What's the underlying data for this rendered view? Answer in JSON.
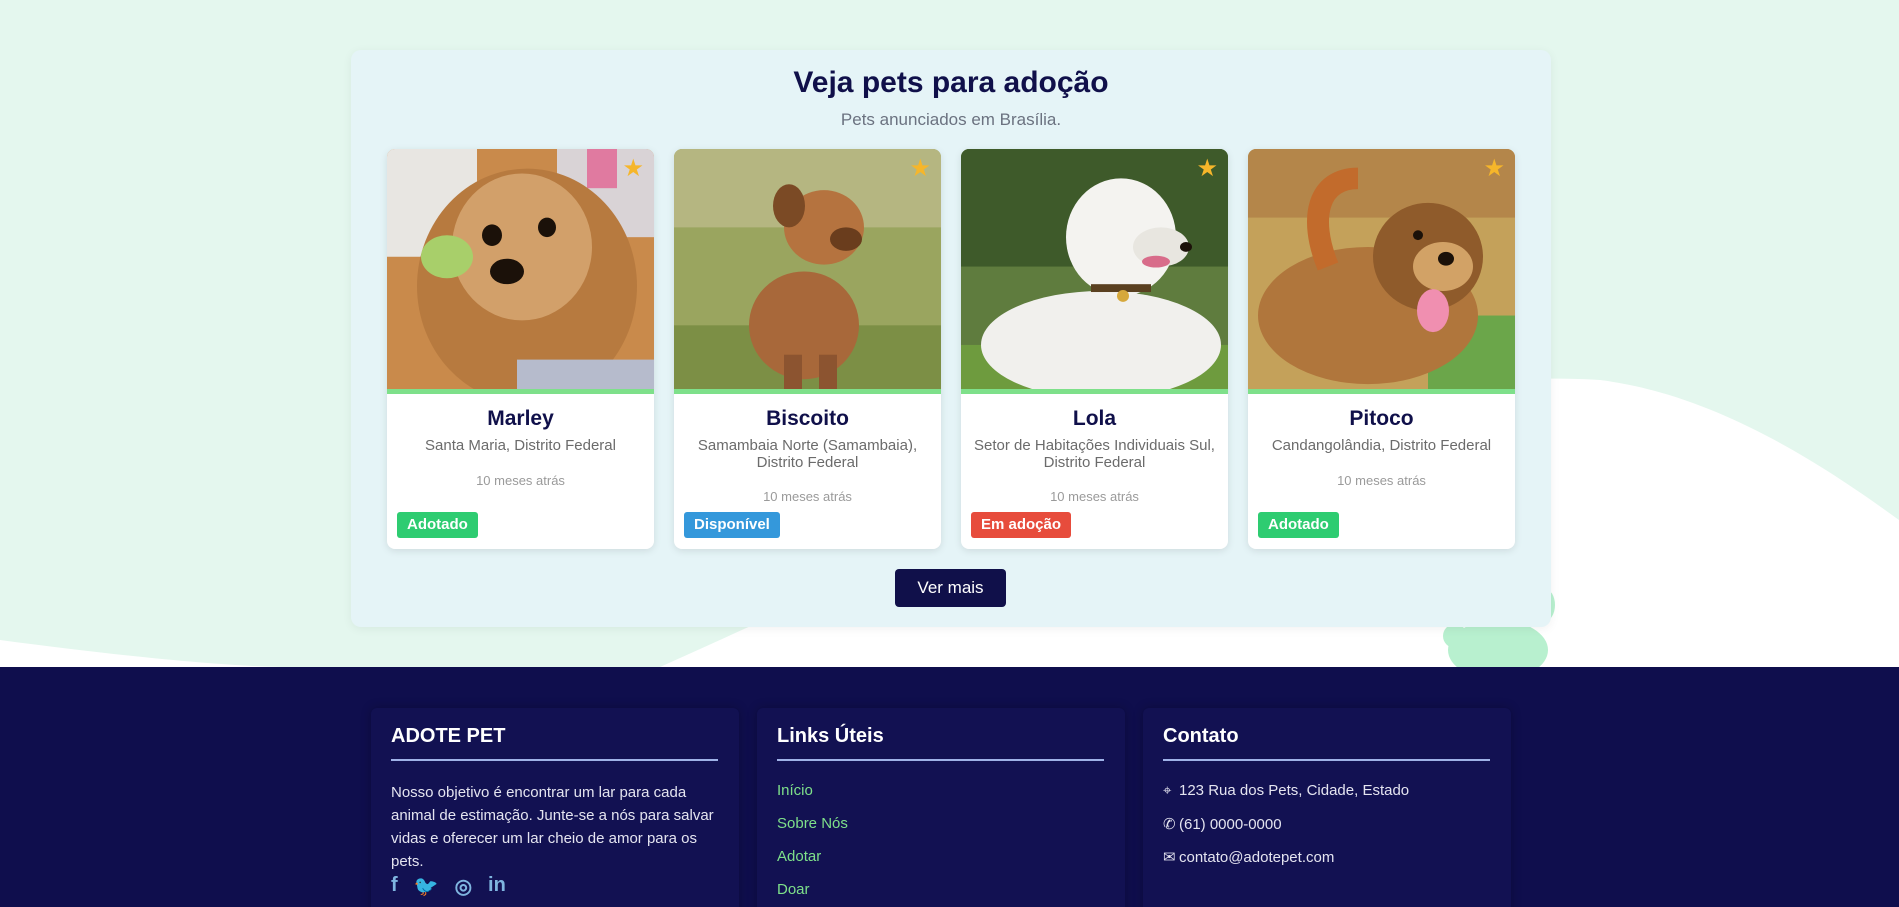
{
  "adoption": {
    "title": "Veja pets para adoção",
    "subtitle": "Pets anunciados em Brasília.",
    "more_button": "Ver mais",
    "pets": [
      {
        "name": "Marley",
        "location": "Santa Maria, Distrito Federal",
        "time": "10 meses atrás",
        "status": "Adotado",
        "status_color": "#2ecc71",
        "favorite_icon": "star-icon"
      },
      {
        "name": "Biscoito",
        "location": "Samambaia Norte (Samambaia), Distrito Federal",
        "time": "10 meses atrás",
        "status": "Disponível",
        "status_color": "#3498db",
        "favorite_icon": "star-icon"
      },
      {
        "name": "Lola",
        "location": "Setor de Habitações Individuais Sul, Distrito Federal",
        "time": "10 meses atrás",
        "status": "Em adoção",
        "status_color": "#e74c3c",
        "favorite_icon": "star-icon"
      },
      {
        "name": "Pitoco",
        "location": "Candangolândia, Distrito Federal",
        "time": "10 meses atrás",
        "status": "Adotado",
        "status_color": "#2ecc71",
        "favorite_icon": "star-icon"
      }
    ]
  },
  "footer": {
    "about": {
      "title": "ADOTE PET",
      "text": "Nosso objetivo é encontrar um lar para cada animal de estimação. Junte-se a nós para salvar vidas e oferecer um lar cheio de amor para os pets.",
      "social_icons": [
        "facebook-icon",
        "twitter-icon",
        "instagram-icon",
        "linkedin-icon"
      ]
    },
    "links": {
      "title": "Links Úteis",
      "items": [
        "Início",
        "Sobre Nós",
        "Adotar",
        "Doar"
      ]
    },
    "contact": {
      "title": "Contato",
      "address": "123 Rua dos Pets, Cidade, Estado",
      "phone": "(61) 0000-0000",
      "email": "contato@adotepet.com"
    }
  },
  "colors": {
    "brand_navy": "#10104a",
    "accent_green": "#7ee08a",
    "background_mint": "#e4f7ee"
  }
}
